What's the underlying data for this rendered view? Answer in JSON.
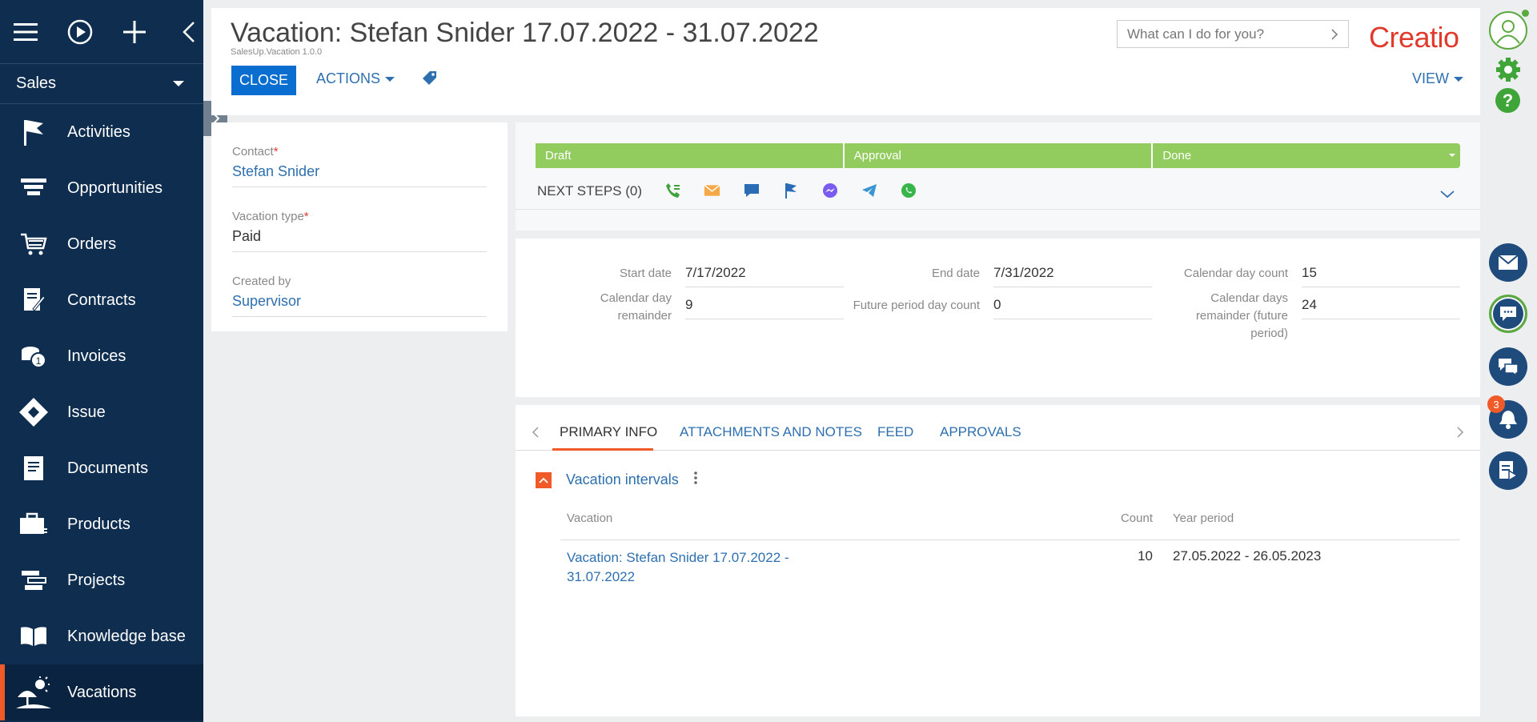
{
  "workspace": "Sales",
  "sidebar": {
    "items": [
      {
        "label": "Activities",
        "icon": "flag-icon"
      },
      {
        "label": "Opportunities",
        "icon": "funnel-icon"
      },
      {
        "label": "Orders",
        "icon": "cart-icon"
      },
      {
        "label": "Contracts",
        "icon": "contract-icon"
      },
      {
        "label": "Invoices",
        "icon": "coins-icon"
      },
      {
        "label": "Issue",
        "icon": "diamond-icon"
      },
      {
        "label": "Documents",
        "icon": "document-icon"
      },
      {
        "label": "Products",
        "icon": "briefcase-icon"
      },
      {
        "label": "Projects",
        "icon": "projects-icon"
      },
      {
        "label": "Knowledge base",
        "icon": "book-icon"
      },
      {
        "label": "Vacations",
        "icon": "beach-umbrella-icon",
        "active": true
      }
    ]
  },
  "header": {
    "title": "Vacation: Stefan Snider 17.07.2022 - 31.07.2022",
    "package": "SalesUp.Vacation 1.0.0",
    "close_label": "CLOSE",
    "actions_label": "ACTIONS",
    "view_label": "VIEW",
    "search_placeholder": "What can I do for you?",
    "logo": "Creatio"
  },
  "info": {
    "contact_label": "Contact",
    "contact_value": "Stefan Snider",
    "type_label": "Vacation type",
    "type_value": "Paid",
    "created_label": "Created by",
    "created_value": "Supervisor"
  },
  "stages": [
    "Draft",
    "Approval",
    "Done"
  ],
  "next_steps_label": "NEXT STEPS (0)",
  "dates": {
    "start_label": "Start date",
    "start_value": "7/17/2022",
    "end_label": "End date",
    "end_value": "7/31/2022",
    "count_label": "Calendar day count",
    "count_value": "15",
    "remainder_label": "Calendar day remainder",
    "remainder_value": "9",
    "future_label": "Future period day count",
    "future_value": "0",
    "future_remainder_label": "Calendar days remainder (future period)",
    "future_remainder_value": "24"
  },
  "tabs": [
    "PRIMARY INFO",
    "ATTACHMENTS AND NOTES",
    "FEED",
    "APPROVALS"
  ],
  "detail": {
    "title": "Vacation intervals",
    "columns": {
      "vacation": "Vacation",
      "count": "Count",
      "year": "Year period"
    },
    "rows": [
      {
        "vacation": "Vacation: Stefan Snider 17.07.2022 - 31.07.2022",
        "count": "10",
        "year": "27.05.2022 - 26.05.2023"
      }
    ]
  },
  "notifications_count": "3",
  "colors": {
    "sidebar": "#0e2d4f",
    "accent": "#f05a28",
    "primary": "#0a6ed1",
    "stage": "#92cb5e"
  }
}
